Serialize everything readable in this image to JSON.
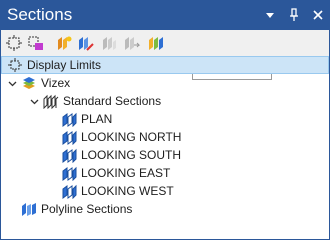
{
  "window": {
    "title": "Sections"
  },
  "titlebar": {
    "menu_icon": "dropdown-arrow",
    "pin_icon": "pin",
    "close_icon": "close"
  },
  "toolbar": {
    "tools": [
      "display-limits-icon",
      "sections-display-icon",
      "new-section-icon",
      "edit-sections-icon",
      "copy-section-icon",
      "move-section-icon",
      "section-set-icon"
    ],
    "combo_value": ""
  },
  "tree": {
    "display_limits": "Display Limits",
    "vizex": "Vizex",
    "standard_sections": "Standard Sections",
    "standard_items": [
      "PLAN",
      "LOOKING NORTH",
      "LOOKING SOUTH",
      "LOOKING EAST",
      "LOOKING WEST"
    ],
    "polyline_sections": "Polyline Sections"
  },
  "colors": {
    "titlebar": "#2b579a",
    "selection": "#cce4f7",
    "section_icon": "#2e6fd3"
  }
}
